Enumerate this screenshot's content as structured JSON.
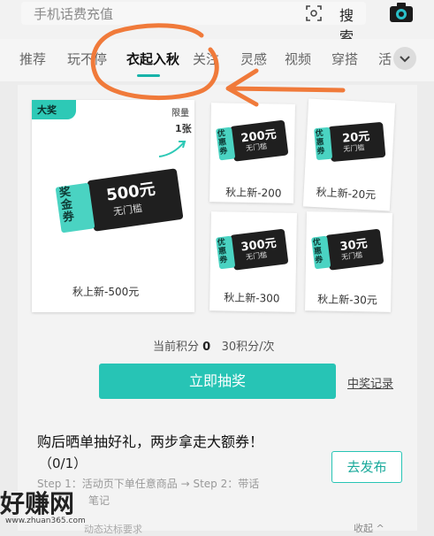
{
  "header": {
    "search_placeholder": "手机话费充值",
    "search_button": "搜索"
  },
  "tabs": [
    {
      "label": "推荐"
    },
    {
      "label": "玩不停"
    },
    {
      "label": "衣起入秋"
    },
    {
      "label": "关注"
    },
    {
      "label": "灵感"
    },
    {
      "label": "视频"
    },
    {
      "label": "穿搭"
    },
    {
      "label": "活"
    }
  ],
  "featured": {
    "corner_tag": "大奖",
    "limit_line1": "限量",
    "limit_line2": "1张",
    "stub": "奖金券",
    "value": "500元",
    "sub": "无门槛",
    "label": "秋上新-500元"
  },
  "coupons": [
    {
      "stub": "优惠券",
      "value": "200元",
      "sub": "无门槛",
      "label": "秋上新-200"
    },
    {
      "stub": "优惠券",
      "value": "20元",
      "sub": "无门槛",
      "label": "秋上新-20元"
    },
    {
      "stub": "优惠券",
      "value": "300元",
      "sub": "无门槛",
      "label": "秋上新-300"
    },
    {
      "stub": "优惠券",
      "value": "30元",
      "sub": "无门槛",
      "label": "秋上新-30元"
    }
  ],
  "points": {
    "prefix": "当前积分",
    "value": "0",
    "cost": "30积分/次"
  },
  "draw_button": "立即抽奖",
  "records_link": "中奖记录",
  "task": {
    "title": "购后晒单抽好礼，两步拿走大额券！",
    "progress": "（0/1）",
    "publish_button": "去发布",
    "steps_line1": "Step 1：活动页下单任意商品 → Step 2：带话",
    "steps_line2": "笔记",
    "footer_left": "动态达标要求",
    "footer_right": "收起 ^"
  },
  "watermark": {
    "text": "好赚网",
    "url": "www.zhuan365.com"
  },
  "colors": {
    "accent": "#27c4b5",
    "annotation": "#f07a3a"
  }
}
